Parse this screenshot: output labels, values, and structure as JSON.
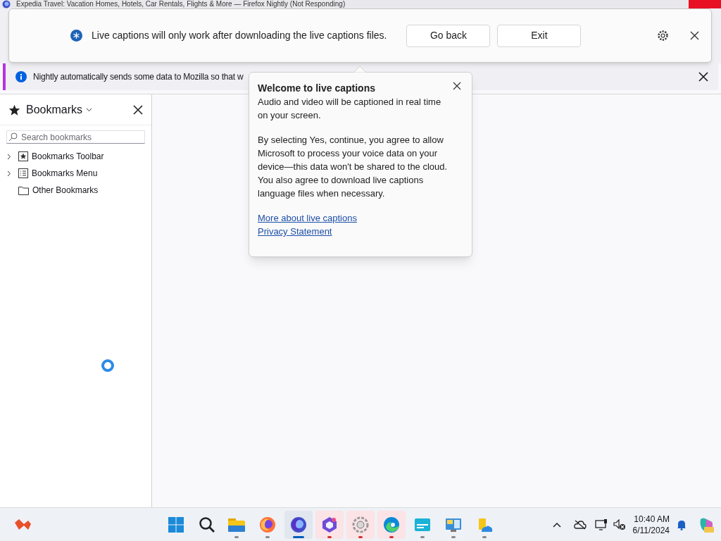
{
  "window": {
    "title": "Expedia Travel: Vacation Homes, Hotels, Car Rentals, Flights & More — Firefox Nightly (Not Responding)"
  },
  "captions_bar": {
    "message": "Live captions will only work after downloading the live captions files.",
    "buttons": [
      "Go back",
      "Exit"
    ]
  },
  "notification": {
    "message": "Nightly automatically sends some data to Mozilla so that w"
  },
  "sidebar": {
    "title": "Bookmarks",
    "search": {
      "placeholder": "Search bookmarks"
    },
    "items": [
      {
        "label": "Bookmarks Toolbar",
        "kind": "toolbar",
        "expandable": true
      },
      {
        "label": "Bookmarks Menu",
        "kind": "menu",
        "expandable": true
      },
      {
        "label": "Other Bookmarks",
        "kind": "folder",
        "expandable": false
      }
    ]
  },
  "popup": {
    "title": "Welcome to live captions",
    "paragraphs": [
      "Audio and video will be captioned in real time on your screen.",
      "By selecting Yes, continue, you agree to allow Microsoft to process your voice data on your device—this data won't be shared to the cloud. You also agree to download live captions language files when necessary."
    ],
    "links": [
      "More about live captions",
      "Privacy Statement"
    ]
  },
  "taskbar": {
    "apps": [
      {
        "kind": "files",
        "active": false,
        "attention": false
      },
      {
        "kind": "firefox",
        "active": false,
        "attention": false
      },
      {
        "kind": "nightly",
        "active": true,
        "attention": false
      },
      {
        "kind": "hexagon",
        "active": false,
        "attention": true
      },
      {
        "kind": "gear",
        "active": false,
        "attention": true
      },
      {
        "kind": "edge",
        "active": false,
        "attention": true
      },
      {
        "kind": "terminal",
        "active": false,
        "attention": false
      },
      {
        "kind": "panel",
        "active": false,
        "attention": false
      },
      {
        "kind": "cloudfolder",
        "active": false,
        "attention": false
      }
    ],
    "clock": {
      "time": "10:40 AM",
      "date": "6/11/2024"
    }
  }
}
